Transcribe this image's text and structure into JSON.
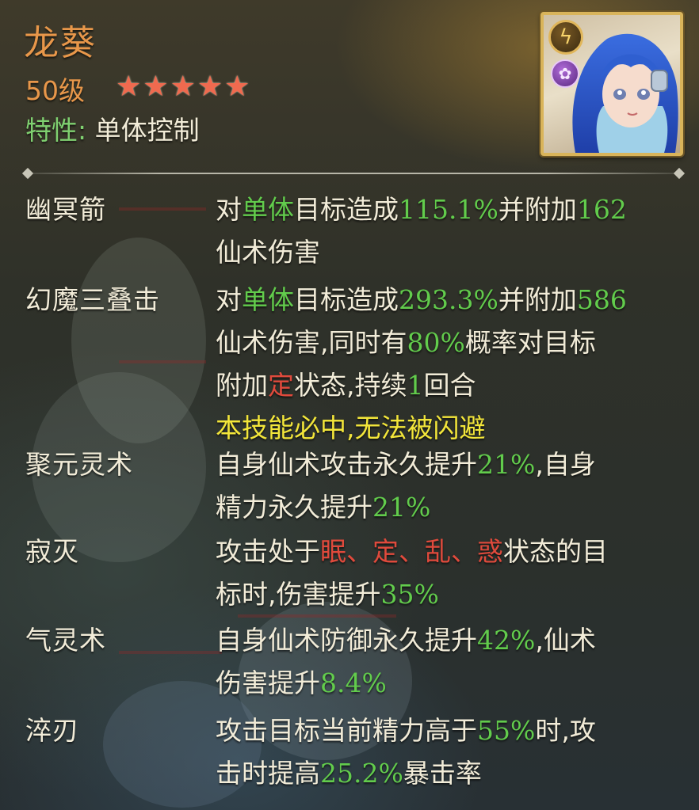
{
  "hero": {
    "name": "龙葵",
    "level": "50级",
    "stars": 5,
    "trait_label": "特性:",
    "trait_value": "单体控制",
    "type_icon": "lightning-icon",
    "element_icon": "rose-icon"
  },
  "colors": {
    "name": "#e8974a",
    "text": "#f2ecd8",
    "highlight_green": "#62cc4c",
    "highlight_red": "#e04a3c",
    "highlight_yellow": "#f3e63a",
    "star": "#ef6a4f",
    "frame": "#d9b45a"
  },
  "skills": [
    {
      "name": "幽冥箭",
      "lines": [
        [
          "对",
          "单体",
          "目标造成",
          "115.1%",
          "并附加",
          "162"
        ],
        [
          "仙术伤害"
        ]
      ]
    },
    {
      "name": "幻魔三叠击",
      "lines": [
        [
          "对",
          "单体",
          "目标造成",
          "293.3%",
          "并附加",
          "586"
        ],
        [
          "仙术伤害,同时有",
          "80%",
          "概率对目标"
        ],
        [
          "附加",
          "定",
          "状态,持续",
          "1",
          "回合"
        ],
        [
          "本技能必中,无法被闪避"
        ]
      ]
    },
    {
      "name": "聚元灵术",
      "lines": [
        [
          "自身仙术攻击永久提升",
          "21%",
          ",自身"
        ],
        [
          "精力永久提升",
          "21%"
        ]
      ]
    },
    {
      "name": "寂灭",
      "lines": [
        [
          "攻击处于",
          "眠、定、乱、惑",
          "状态的目"
        ],
        [
          "标时,伤害提升",
          "35%"
        ]
      ]
    },
    {
      "name": "气灵术",
      "lines": [
        [
          "自身仙术防御永久提升",
          "42%",
          ",仙术"
        ],
        [
          "伤害提升",
          "8.4%"
        ]
      ]
    },
    {
      "name": "淬刃",
      "lines": [
        [
          "攻击目标当前精力高于",
          "55%",
          "时,攻"
        ],
        [
          "击时提高",
          "25.2%",
          "暴击率"
        ]
      ]
    }
  ]
}
